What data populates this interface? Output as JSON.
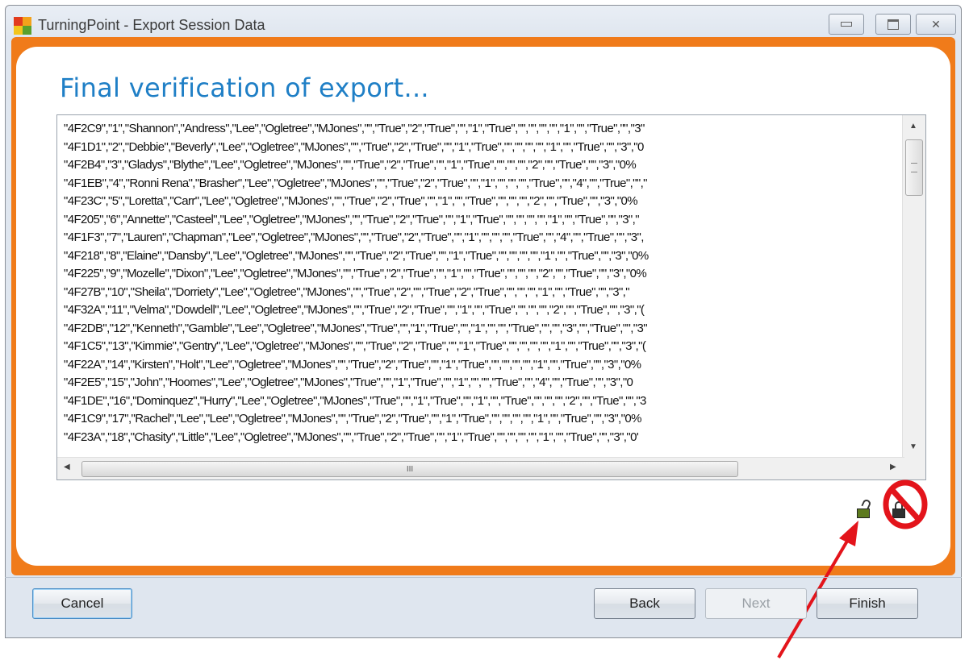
{
  "window": {
    "title": "TurningPoint - Export Session Data",
    "controls": {
      "minimize": "▭",
      "maximize": "▢",
      "close": "✕"
    }
  },
  "heading": "Final verification of export...",
  "export_lines": [
    "\"4F2C9\",\"1\",\"Shannon\",\"Andress\",\"Lee\",\"Ogletree\",\"MJones\",\"\",\"True\",\"2\",\"True\",\"\",\"1\",\"True\",\"\",\"\",\"\",\"\",\"1\",\"\",\"True\",\"\",\"3\"",
    "\"4F1D1\",\"2\",\"Debbie\",\"Beverly\",\"Lee\",\"Ogletree\",\"MJones\",\"\",\"True\",\"2\",\"True\",\"\",\"1\",\"True\",\"\",\"\",\"\",\"\",\"1\",\"\",\"True\",\"\",\"3\",\"0",
    "\"4F2B4\",\"3\",\"Gladys\",\"Blythe\",\"Lee\",\"Ogletree\",\"MJones\",\"\",\"True\",\"2\",\"True\",\"\",\"1\",\"True\",\"\",\"\",\"\",\"2\",\"\",\"True\",\"\",\"3\",\"0%",
    "\"4F1EB\",\"4\",\"Ronni Rena\",\"Brasher\",\"Lee\",\"Ogletree\",\"MJones\",\"\",\"True\",\"2\",\"True\",\"\",\"1\",\"\",\"\",\"\",\"True\",\"\",\"4\",\"\",\"True\",\"\",\"",
    "\"4F23C\",\"5\",\"Loretta\",\"Carr\",\"Lee\",\"Ogletree\",\"MJones\",\"\",\"True\",\"2\",\"True\",\"\",\"1\",\"\",\"True\",\"\",\"\",\"\",\"2\",\"\",\"True\",\"\",\"3\",\"0%",
    "\"4F205\",\"6\",\"Annette\",\"Casteel\",\"Lee\",\"Ogletree\",\"MJones\",\"\",\"True\",\"2\",\"True\",\"\",\"1\",\"True\",\"\",\"\",\"\",\"\",\"1\",\"\",\"True\",\"\",\"3\",\"",
    "\"4F1F3\",\"7\",\"Lauren\",\"Chapman\",\"Lee\",\"Ogletree\",\"MJones\",\"\",\"True\",\"2\",\"True\",\"\",\"1\",\"\",\"\",\"\",\"True\",\"\",\"4\",\"\",\"True\",\"\",\"3\",",
    "\"4F218\",\"8\",\"Elaine\",\"Dansby\",\"Lee\",\"Ogletree\",\"MJones\",\"\",\"True\",\"2\",\"True\",\"\",\"1\",\"True\",\"\",\"\",\"\",\"\",\"1\",\"\",\"True\",\"\",\"3\",\"0%",
    "\"4F225\",\"9\",\"Mozelle\",\"Dixon\",\"Lee\",\"Ogletree\",\"MJones\",\"\",\"True\",\"2\",\"True\",\"\",\"1\",\"\",\"True\",\"\",\"\",\"\",\"2\",\"\",\"True\",\"\",\"3\",\"0%",
    "\"4F27B\",\"10\",\"Sheila\",\"Dorriety\",\"Lee\",\"Ogletree\",\"MJones\",\"\",\"True\",\"2\",\"\",\"True\",\"2\",\"True\",\"\",\"\",\"\",\"1\",\"\",\"True\",\"\",\"3\",\"",
    "\"4F32A\",\"11\",\"Velma\",\"Dowdell\",\"Lee\",\"Ogletree\",\"MJones\",\"\",\"True\",\"2\",\"True\",\"\",\"1\",\"\",\"True\",\"\",\"\",\"\",\"2\",\"\",\"True\",\"\",\"3\",\"(",
    "\"4F2DB\",\"12\",\"Kenneth\",\"Gamble\",\"Lee\",\"Ogletree\",\"MJones\",\"True\",\"\",\"1\",\"True\",\"\",\"1\",\"\",\"\",\"True\",\"\",\"\",\"3\",\"\",\"True\",\"\",\"3\"",
    "\"4F1C5\",\"13\",\"Kimmie\",\"Gentry\",\"Lee\",\"Ogletree\",\"MJones\",\"\",\"True\",\"2\",\"True\",\"\",\"1\",\"True\",\"\",\"\",\"\",\"\",\"1\",\"\",\"True\",\"\",\"3\",\"(",
    "\"4F22A\",\"14\",\"Kirsten\",\"Holt\",\"Lee\",\"Ogletree\",\"MJones\",\"\",\"True\",\"2\",\"True\",\"\",\"1\",\"True\",\"\",\"\",\"\",\"\",\"1\",\"\",\"True\",\"\",\"3\",\"0%",
    "\"4F2E5\",\"15\",\"John\",\"Hoomes\",\"Lee\",\"Ogletree\",\"MJones\",\"True\",\"\",\"1\",\"True\",\"\",\"1\",\"\",\"\",\"True\",\"\",\"4\",\"\",\"True\",\"\",\"3\",\"0",
    "\"4F1DE\",\"16\",\"Dominquez\",\"Hurry\",\"Lee\",\"Ogletree\",\"MJones\",\"True\",\"\",\"1\",\"True\",\"\",\"1\",\"\",\"True\",\"\",\"\",\"\",\"2\",\"\",\"True\",\"\",\"3",
    "\"4F1C9\",\"17\",\"Rachel\",\"Lee\",\"Lee\",\"Ogletree\",\"MJones\",\"\",\"True\",\"2\",\"True\",\"\",\"1\",\"True\",\"\",\"\",\"\",\"\",\"1\",\"\",\"True\",\"\",\"3\",\"0%",
    "\"4F23A\",\"18\",\"Chasity\",\"Little\",\"Lee\",\"Ogletree\",\"MJones\",\"\",\"True\",\"2\",\"True\",\"\",\"1\",\"True\",\"\",\"\",\"\",\"\",\"1\",\"\",\"True\",\"\",\"3\",\"0'"
  ],
  "scrollbar": {
    "grip_glyph": "III"
  },
  "buttons": {
    "cancel": "Cancel",
    "back": "Back",
    "next": "Next",
    "finish": "Finish"
  },
  "icons": {
    "unlocked": "unlocked-padlock-icon",
    "locked": "locked-padlock-icon",
    "prohibited": "prohibited-sign"
  },
  "colors": {
    "frame_orange": "#f07b1a",
    "heading_blue": "#1f7fc6",
    "annotation_red": "#e3141b"
  }
}
